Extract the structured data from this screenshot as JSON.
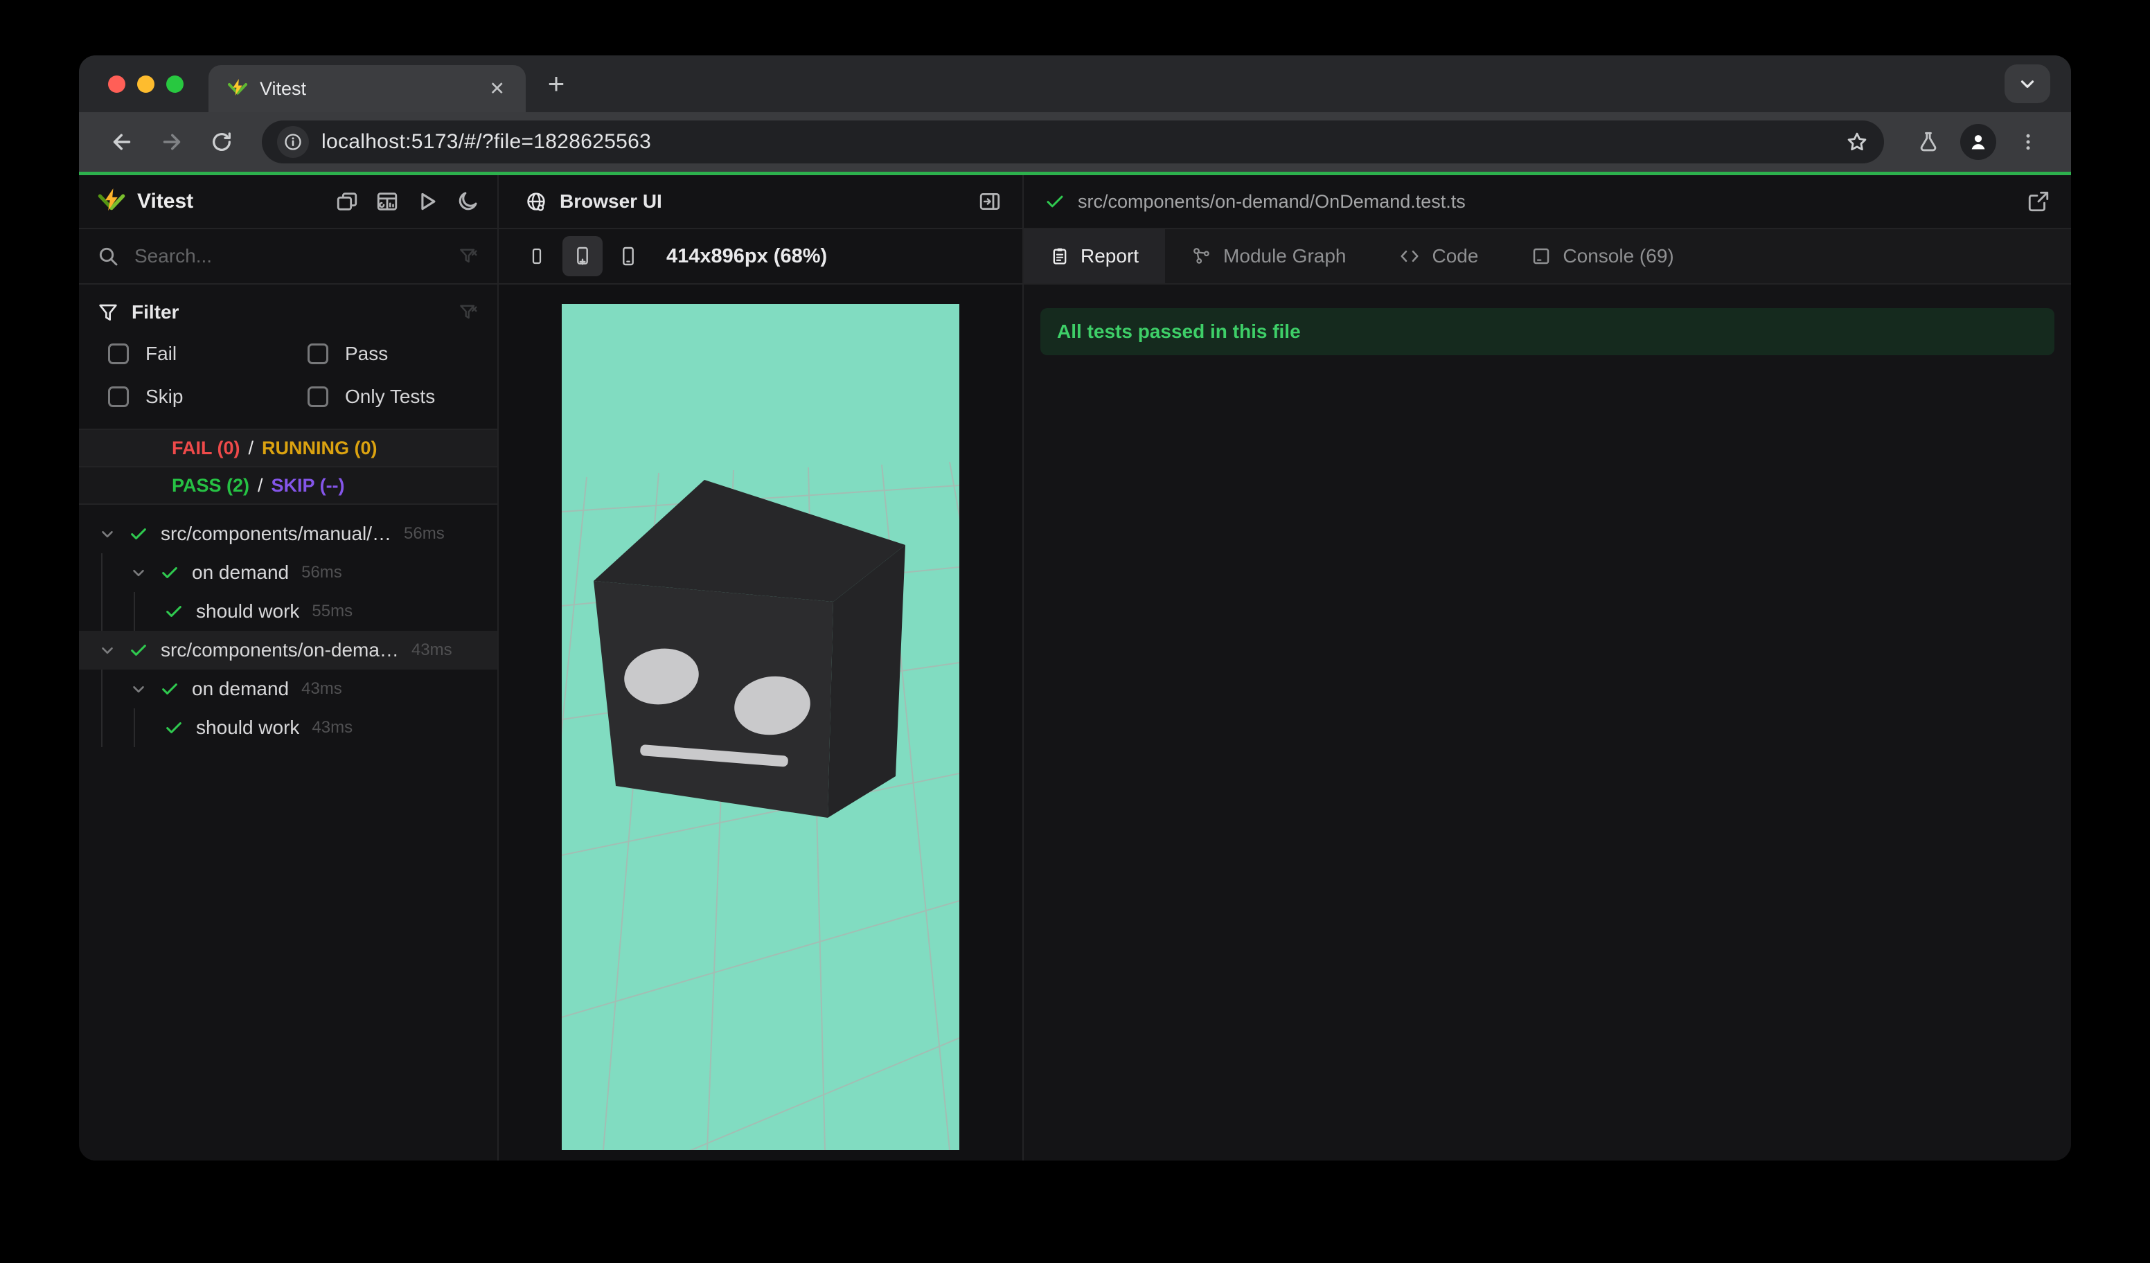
{
  "browser_chrome": {
    "tab": {
      "title": "Vitest",
      "close_glyph": "✕"
    },
    "new_tab_glyph": "+",
    "url": "localhost:5173/#/?file=1828625563",
    "colors": {
      "traffic_red": "#ff5f57",
      "traffic_yellow": "#febc2e",
      "traffic_green": "#28c840",
      "progress_green": "#2db14d"
    }
  },
  "sidebar": {
    "title": "Vitest",
    "search_placeholder": "Search...",
    "filter": {
      "title": "Filter",
      "options": [
        "Fail",
        "Pass",
        "Skip",
        "Only Tests"
      ]
    },
    "status": {
      "fail": "FAIL (0)",
      "sep1": "/",
      "running": "RUNNING (0)",
      "pass": "PASS (2)",
      "sep2": "/",
      "skip": "SKIP (--)",
      "colors": {
        "fail": "#ef4a4a",
        "running": "#dca310",
        "pass": "#26c244",
        "skip": "#8455e9"
      }
    },
    "tree": {
      "rows": [
        {
          "label": "src/components/manual/…",
          "duration": "56ms",
          "depth": 0,
          "chevron": true,
          "selected": false
        },
        {
          "label": "on demand",
          "duration": "56ms",
          "depth": 1,
          "chevron": true,
          "selected": false
        },
        {
          "label": "should work",
          "duration": "55ms",
          "depth": 2,
          "chevron": false,
          "selected": false
        },
        {
          "label": "src/components/on-dema…",
          "duration": "43ms",
          "depth": 0,
          "chevron": true,
          "selected": true
        },
        {
          "label": "on demand",
          "duration": "43ms",
          "depth": 1,
          "chevron": true,
          "selected": false
        },
        {
          "label": "should work",
          "duration": "43ms",
          "depth": 2,
          "chevron": false,
          "selected": false
        }
      ]
    }
  },
  "browser_panel": {
    "title": "Browser UI",
    "size_label": "414x896px (68%)"
  },
  "report_panel": {
    "file_path": "src/components/on-demand/OnDemand.test.ts",
    "tabs": [
      {
        "label": "Report"
      },
      {
        "label": "Module Graph"
      },
      {
        "label": "Code"
      },
      {
        "label": "Console (69)"
      }
    ],
    "banner": "All tests passed in this file",
    "banner_color": "#3ecf68"
  },
  "viewport": {
    "colors": {
      "background": "#81dcc1",
      "grid": "#aeb5b0",
      "cube_front": "#2c2c2e",
      "cube_top": "#272729",
      "cube_side": "#242426",
      "face": "#c9c9cb"
    }
  },
  "icons": [
    "vitest-logo",
    "favicon",
    "tab-close-icon",
    "new-tab-icon",
    "tab-search-chevron-icon",
    "back-icon",
    "forward-icon",
    "refresh-icon",
    "info-icon",
    "star-icon",
    "flask-icon",
    "profile-icon",
    "kebab-menu-icon",
    "search-icon",
    "funnel-icon",
    "clear-filter-icon",
    "chevron-down-icon",
    "check-icon",
    "detail-view-icon",
    "dashboard-icon",
    "run-all-icon",
    "dark-mode-icon",
    "globe-icon",
    "dock-right-icon",
    "phone-small-icon",
    "phone-plus-icon",
    "phone-frame-icon",
    "report-icon",
    "module-graph-icon",
    "code-icon",
    "console-icon",
    "external-link-icon"
  ]
}
